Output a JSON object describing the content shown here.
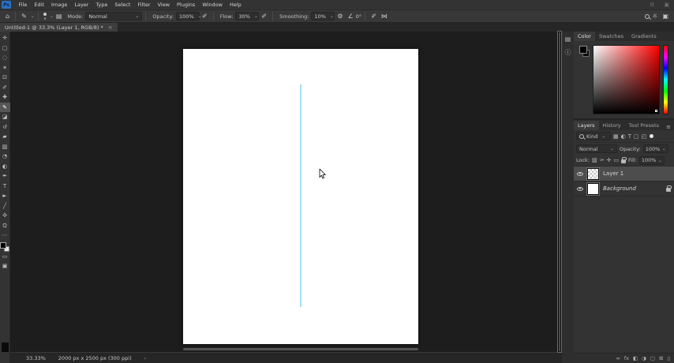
{
  "app": {
    "logo_text": "Ps",
    "accent_blue": "#31a8ff",
    "theme_bg": "#333333",
    "canvas_bg": "#1d1d1d"
  },
  "menu": {
    "items": [
      "File",
      "Edit",
      "Image",
      "Layer",
      "Type",
      "Select",
      "Filter",
      "View",
      "Plugins",
      "Window",
      "Help"
    ]
  },
  "titlebar": {
    "gear_icon": "⚙",
    "restore_icon": "▣"
  },
  "options": {
    "home_icon": "⌂",
    "brush_tool_icon": "✎",
    "chevron": "⌄",
    "toggle_panel_icon": "▤",
    "mode_label": "Mode:",
    "mode_value": "Normal",
    "opacity_label": "Opacity:",
    "opacity_value": "100%",
    "pressure_opacity_icon": "✐",
    "flow_label": "Flow:",
    "flow_value": "30%",
    "airbrush_icon": "✐",
    "smoothing_label": "Smoothing:",
    "smoothing_value": "10%",
    "smoothing_gear_icon": "⚙",
    "angle_icon": "∠",
    "angle_value": "0°",
    "pressure_size_icon": "✐",
    "symmetry_icon": "⋈",
    "learn_icon": "☼",
    "workspace_icon": "▣"
  },
  "document_tab": {
    "title": "Untitled-1 @ 33.3% (Layer 1, RGB/8) *",
    "close": "×"
  },
  "toolbar": {
    "tools": [
      {
        "name": "move-tool",
        "glyph": "✛"
      },
      {
        "name": "marquee-tool",
        "glyph": "▢"
      },
      {
        "name": "lasso-tool",
        "glyph": "◌"
      },
      {
        "name": "object-selection-tool",
        "glyph": "✶"
      },
      {
        "name": "crop-tool",
        "glyph": "⊡"
      },
      {
        "name": "eyedropper-tool",
        "glyph": "✐"
      },
      {
        "name": "healing-brush-tool",
        "glyph": "✚"
      },
      {
        "name": "brush-tool",
        "glyph": "✎"
      },
      {
        "name": "clone-stamp-tool",
        "glyph": "◪"
      },
      {
        "name": "history-brush-tool",
        "glyph": "↺"
      },
      {
        "name": "eraser-tool",
        "glyph": "▰"
      },
      {
        "name": "gradient-tool",
        "glyph": "▨"
      },
      {
        "name": "blur-tool",
        "glyph": "◔"
      },
      {
        "name": "dodge-tool",
        "glyph": "◐"
      },
      {
        "name": "pen-tool",
        "glyph": "✒"
      },
      {
        "name": "type-tool",
        "glyph": "T"
      },
      {
        "name": "path-selection-tool",
        "glyph": "►"
      },
      {
        "name": "line-tool",
        "glyph": "╱"
      },
      {
        "name": "hand-tool",
        "glyph": "✣"
      },
      {
        "name": "zoom-tool",
        "glyph": "Q"
      },
      {
        "name": "edit-toolbar",
        "glyph": "⋯"
      }
    ],
    "active_tool": "brush-tool",
    "foreground_color": "#000000",
    "background_color": "#ffffff"
  },
  "canvas": {
    "line_color": "#a6ddf1"
  },
  "dock": {
    "panel_icon": "▤",
    "info_icon": "ⓘ"
  },
  "panels": {
    "color": {
      "tabs": [
        "Color",
        "Swatches",
        "Gradients"
      ],
      "foreground": "#000000",
      "background": "#000000",
      "field_base": "#ff0000",
      "hue_colors": [
        "#ff0000",
        "#ff00ff",
        "#0000ff",
        "#00ffff",
        "#00ff00",
        "#ffff00",
        "#ff0000"
      ]
    },
    "layers": {
      "tabs": [
        "Layers",
        "History",
        "Tool Presets"
      ],
      "menu_icon": "≡",
      "kind_label": "Kind",
      "filter_icons": [
        {
          "name": "filter-pixel-icon",
          "glyph": "▦"
        },
        {
          "name": "filter-adjustment-icon",
          "glyph": "◐"
        },
        {
          "name": "filter-type-icon",
          "glyph": "T"
        },
        {
          "name": "filter-shape-icon",
          "glyph": "▢"
        },
        {
          "name": "filter-smart-object-icon",
          "glyph": "◰"
        }
      ],
      "blend_mode": "Normal",
      "opacity_label": "Opacity:",
      "opacity_value": "100%",
      "lock_label": "Lock:",
      "lock_icons": [
        {
          "name": "lock-transparency-icon",
          "glyph": "▨"
        },
        {
          "name": "lock-pixels-icon",
          "glyph": "✑"
        },
        {
          "name": "lock-position-icon",
          "glyph": "✛"
        },
        {
          "name": "lock-artboard-icon",
          "glyph": "▭"
        }
      ],
      "fill_label": "Fill:",
      "fill_value": "100%",
      "rows": [
        {
          "name": "Layer 1",
          "selected": true
        },
        {
          "name": "Background",
          "locked": true
        }
      ],
      "bottom_icons": [
        {
          "name": "link-layers-icon",
          "glyph": "∞"
        },
        {
          "name": "layer-effects-icon",
          "glyph": "fx"
        },
        {
          "name": "layer-mask-icon",
          "glyph": "◧"
        },
        {
          "name": "adjustment-layer-icon",
          "glyph": "◑"
        },
        {
          "name": "new-group-icon",
          "glyph": "▢"
        },
        {
          "name": "new-layer-icon",
          "glyph": "⊞"
        },
        {
          "name": "delete-layer-icon",
          "glyph": "▯"
        }
      ]
    }
  },
  "status_bar": {
    "zoom": "33.33%",
    "doc_info": "2000 px x 2500 px (300 ppi)",
    "chevron": "›"
  }
}
